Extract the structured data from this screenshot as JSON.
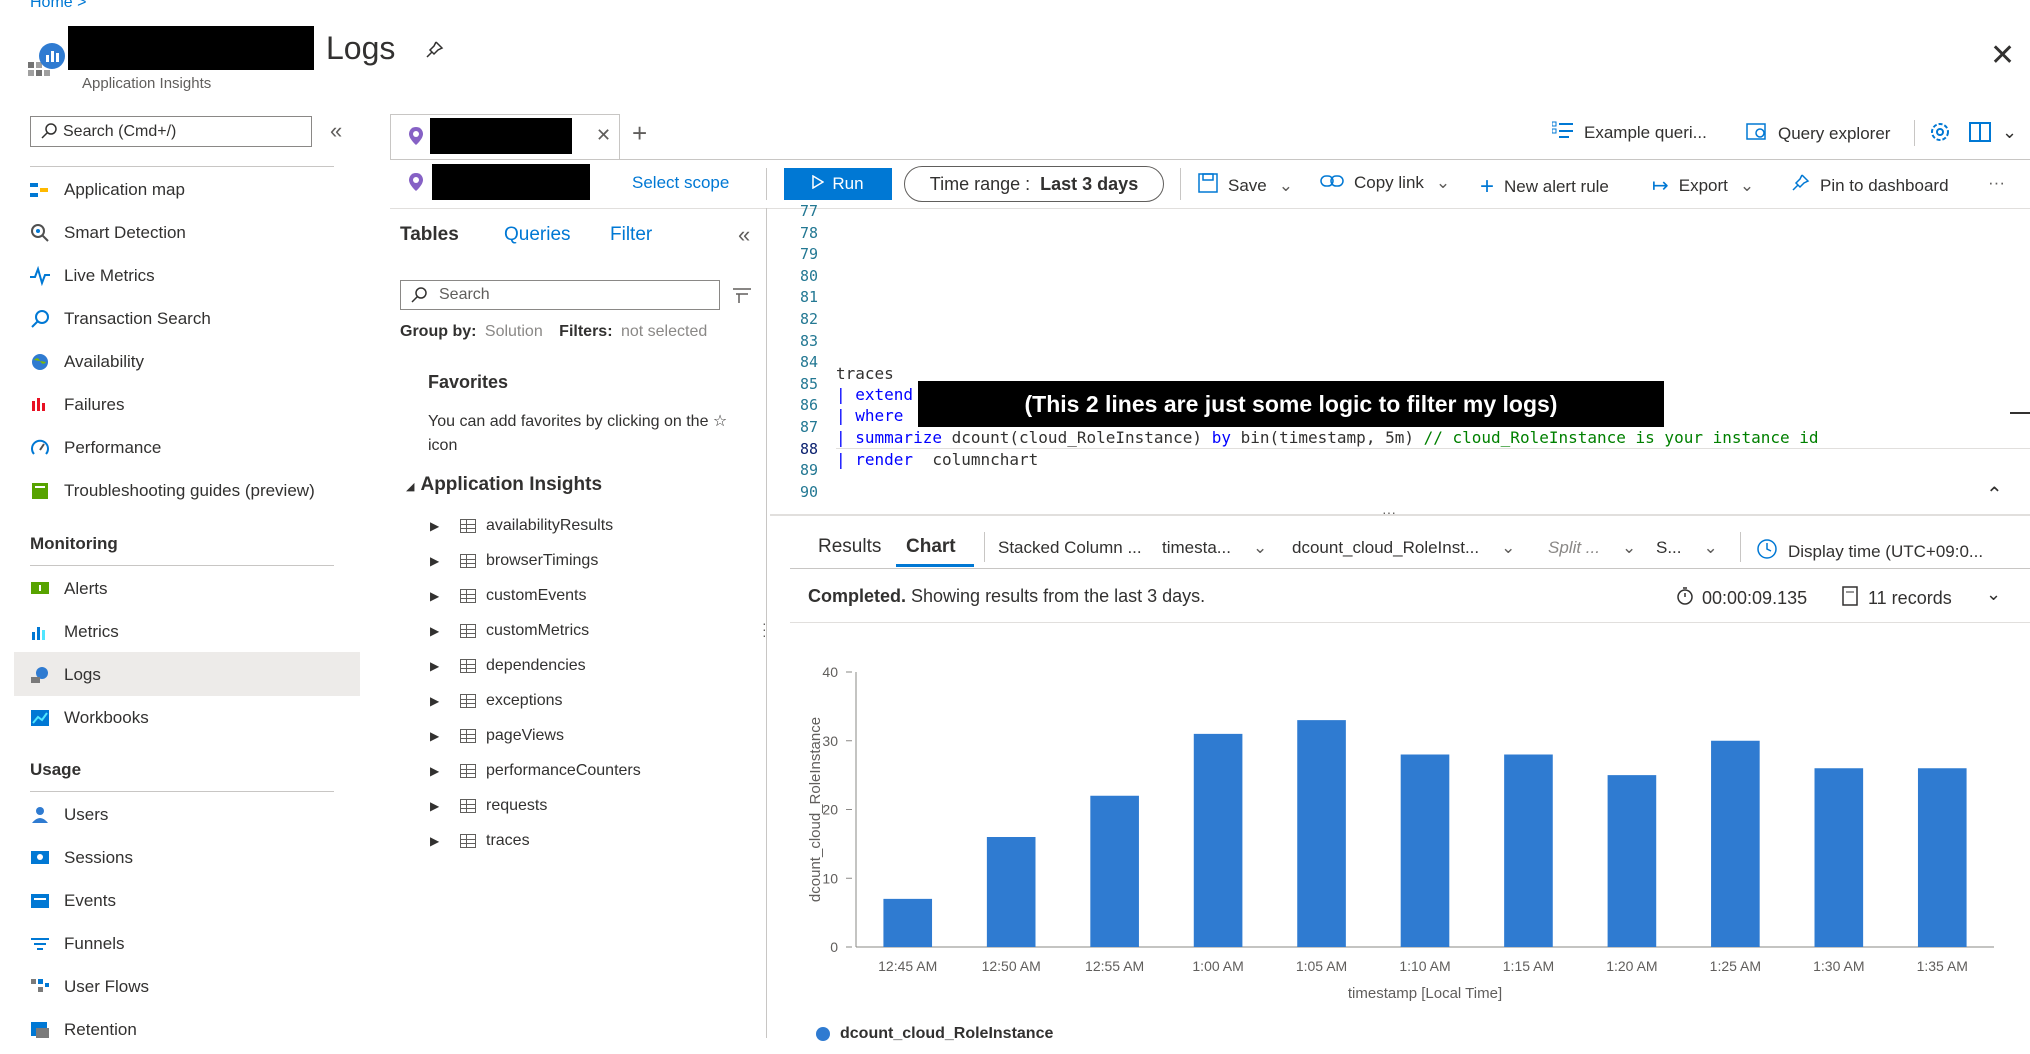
{
  "header": {
    "breadcrumb": "Home >",
    "title": "Logs",
    "subtitle": "Application Insights"
  },
  "nav": {
    "search_placeholder": "Search (Cmd+/)",
    "items": [
      {
        "label": "Application map",
        "icon": "application-map-icon"
      },
      {
        "label": "Smart Detection",
        "icon": "smart-detection-icon"
      },
      {
        "label": "Live Metrics",
        "icon": "live-metrics-icon"
      },
      {
        "label": "Transaction Search",
        "icon": "search-icon"
      },
      {
        "label": "Availability",
        "icon": "globe-icon"
      },
      {
        "label": "Failures",
        "icon": "failures-icon"
      },
      {
        "label": "Performance",
        "icon": "performance-icon"
      },
      {
        "label": "Troubleshooting guides (preview)",
        "icon": "book-icon"
      }
    ],
    "monitoring_heading": "Monitoring",
    "monitoring_items": [
      {
        "label": "Alerts",
        "icon": "alerts-icon"
      },
      {
        "label": "Metrics",
        "icon": "metrics-icon"
      },
      {
        "label": "Logs",
        "icon": "logs-icon"
      },
      {
        "label": "Workbooks",
        "icon": "workbooks-icon"
      }
    ],
    "usage_heading": "Usage",
    "usage_items": [
      {
        "label": "Users",
        "icon": "users-icon"
      },
      {
        "label": "Sessions",
        "icon": "sessions-icon"
      },
      {
        "label": "Events",
        "icon": "events-icon"
      },
      {
        "label": "Funnels",
        "icon": "funnels-icon"
      },
      {
        "label": "User Flows",
        "icon": "user-flows-icon"
      },
      {
        "label": "Retention",
        "icon": "retention-icon"
      }
    ]
  },
  "toolbar": {
    "select_scope": "Select scope",
    "run": "Run",
    "time_range_label": "Time range :",
    "time_range_value": "Last 3 days",
    "save": "Save",
    "copy_link": "Copy link",
    "new_alert_rule": "New alert rule",
    "export": "Export",
    "pin_to_dashboard": "Pin to dashboard",
    "more": "···",
    "example_queries": "Example queri...",
    "query_explorer": "Query explorer"
  },
  "schema": {
    "tabs": [
      "Tables",
      "Queries",
      "Filter"
    ],
    "search_placeholder": "Search",
    "group_by_label": "Group by:",
    "group_by_value": "Solution",
    "filters_label": "Filters:",
    "filters_value": "not selected",
    "favorites_heading": "Favorites",
    "favorites_text": "You can add favorites by clicking on the ☆ icon",
    "section": "Application Insights",
    "tables": [
      "availabilityResults",
      "browserTimings",
      "customEvents",
      "customMetrics",
      "dependencies",
      "exceptions",
      "pageViews",
      "performanceCounters",
      "requests",
      "traces"
    ]
  },
  "editor": {
    "line_numbers": [
      "77",
      "78",
      "79",
      "80",
      "81",
      "82",
      "83",
      "84",
      "85",
      "86",
      "87",
      "88",
      "89",
      "90"
    ],
    "line84": "traces",
    "line85_pipe": "| ",
    "line85_kw": "extend",
    "line86_pipe": "| ",
    "line86_kw": "where",
    "line87_pipe": "| ",
    "line87_kw": "summarize",
    "line87_code": " dcount(cloud_RoleInstance) ",
    "line87_by": "by",
    "line87_code2": " bin(timestamp, 5m) ",
    "line87_comment": "// cloud_RoleInstance is your instance id",
    "line88_pipe": "| ",
    "line88_kw": "render",
    "line88_code": "  columnchart",
    "annotation": "(This 2 lines are just some logic to filter my logs)"
  },
  "results": {
    "tabs": [
      "Results",
      "Chart"
    ],
    "chart_type": "Stacked Column ...",
    "x_select": "timesta...",
    "y_select": "dcount_cloud_RoleInst...",
    "split_select": "Split ...",
    "s_select": "S...",
    "display_time": "Display time (UTC+09:0...",
    "status_bold": "Completed.",
    "status_text": " Showing results from the last 3 days.",
    "duration": "00:00:09.135",
    "records": "11 records"
  },
  "chart_data": {
    "type": "bar",
    "categories": [
      "12:45 AM",
      "12:50 AM",
      "12:55 AM",
      "1:00 AM",
      "1:05 AM",
      "1:10 AM",
      "1:15 AM",
      "1:20 AM",
      "1:25 AM",
      "1:30 AM",
      "1:35 AM"
    ],
    "series": [
      {
        "name": "dcount_cloud_RoleInstance",
        "values": [
          7,
          16,
          22,
          31,
          33,
          28,
          28,
          25,
          30,
          26,
          26
        ]
      }
    ],
    "xlabel": "timestamp [Local Time]",
    "ylabel": "dcount_cloud_RoleInstance",
    "ylim": [
      0,
      40
    ],
    "yticks": [
      0,
      10,
      20,
      30,
      40
    ],
    "color": "#2f7bd1",
    "legend": "bottom-left"
  }
}
